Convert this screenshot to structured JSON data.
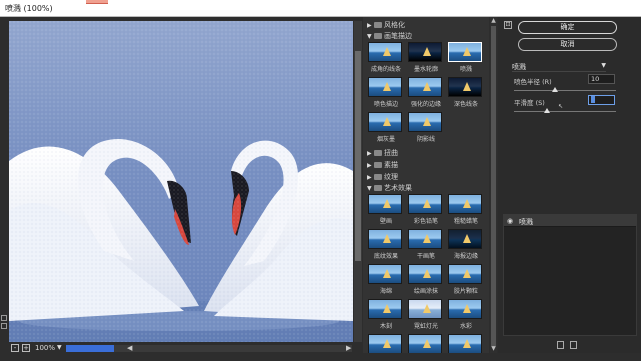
{
  "window": {
    "title": "喷溅 (100%)"
  },
  "status": {
    "zoom": "100%",
    "zoom_out": "-",
    "zoom_in": "+"
  },
  "gallery": {
    "folders": [
      {
        "name": "风格化",
        "expanded": false
      },
      {
        "name": "画笔描边",
        "expanded": true
      },
      {
        "name": "扭曲",
        "expanded": false
      },
      {
        "name": "素描",
        "expanded": false
      },
      {
        "name": "纹理",
        "expanded": false
      },
      {
        "name": "艺术效果",
        "expanded": true
      }
    ],
    "brush_filters": [
      {
        "label": "成角的线条",
        "style": "normal"
      },
      {
        "label": "墨水轮廓",
        "style": "dark"
      },
      {
        "label": "喷溅",
        "style": "normal",
        "selected": true
      },
      {
        "label": "喷色描边",
        "style": "normal"
      },
      {
        "label": "强化的边缘",
        "style": "normal"
      },
      {
        "label": "深色线条",
        "style": "dark"
      },
      {
        "label": "烟灰墨",
        "style": "normal"
      },
      {
        "label": "阴影线",
        "style": "normal"
      }
    ],
    "art_filters": [
      {
        "label": "壁画",
        "style": "normal"
      },
      {
        "label": "彩色铅笔",
        "style": "normal"
      },
      {
        "label": "粗糙蜡笔",
        "style": "normal"
      },
      {
        "label": "底纹效果",
        "style": "normal"
      },
      {
        "label": "干画笔",
        "style": "normal"
      },
      {
        "label": "海报边缘",
        "style": "neon"
      },
      {
        "label": "海绵",
        "style": "normal"
      },
      {
        "label": "绘画涂抹",
        "style": "normal"
      },
      {
        "label": "胶片颗粒",
        "style": "normal"
      },
      {
        "label": "木刻",
        "style": "normal"
      },
      {
        "label": "霓虹灯光",
        "style": "pale"
      },
      {
        "label": "水彩",
        "style": "normal"
      },
      {
        "label": "",
        "style": "normal"
      },
      {
        "label": "",
        "style": "normal"
      },
      {
        "label": "",
        "style": "normal"
      }
    ]
  },
  "settings": {
    "ok_label": "确定",
    "cancel_label": "取消",
    "filter_name": "喷溅",
    "params": [
      {
        "label": "喷色半径 (R)",
        "value": "10",
        "slider_fraction": 0.4
      },
      {
        "label": "平滑度 (S)",
        "value": "",
        "slider_fraction": 0.32
      }
    ]
  },
  "layers": {
    "items": [
      {
        "name": "喷溅",
        "visible": true
      }
    ]
  },
  "colors": {
    "selection_border": "#ffffff",
    "scroll_thumb": "#3a6ed8",
    "focus_border": "#6d9fe8"
  }
}
